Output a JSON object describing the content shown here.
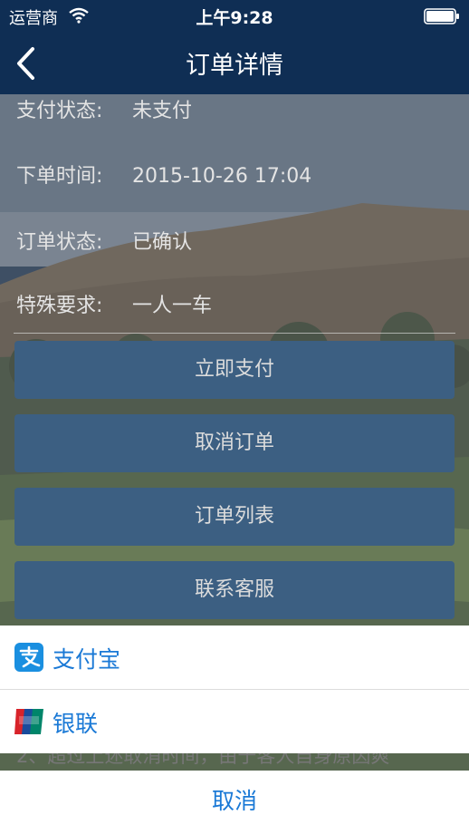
{
  "status_bar": {
    "carrier": "运营商",
    "time": "上午9:28"
  },
  "nav": {
    "title": "订单详情"
  },
  "order": {
    "rows": [
      {
        "label": "支付状态:",
        "value": "未支付"
      },
      {
        "label": "下单时间:",
        "value": "2015-10-26 17:04"
      },
      {
        "label": "订单状态:",
        "value": "已确认"
      },
      {
        "label": "特殊要求:",
        "value": "一人一车"
      }
    ]
  },
  "actions": {
    "pay_now": "立即支付",
    "cancel_order": "取消订单",
    "order_list": "订单列表",
    "contact_service": "联系客服"
  },
  "background_note": "2、超过上述取消时间，由于客人自身原因爽",
  "payment_sheet": {
    "alipay": "支付宝",
    "unionpay": "银联",
    "cancel": "取消"
  }
}
